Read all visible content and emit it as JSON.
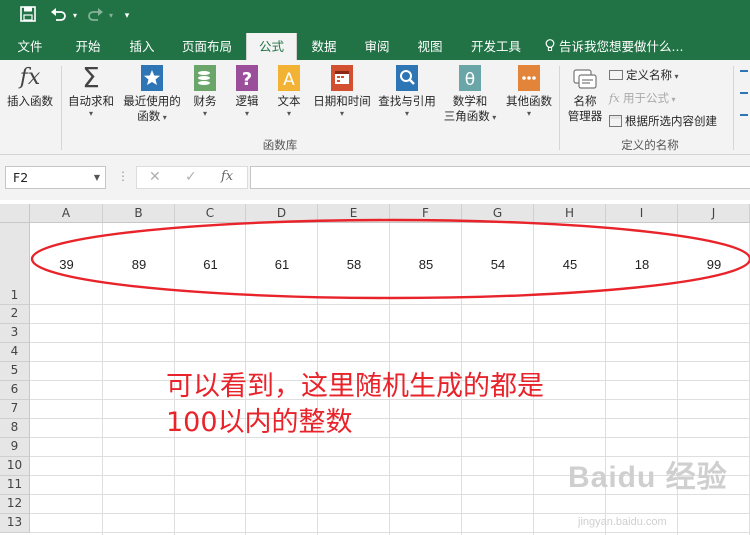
{
  "tabs": [
    "文件",
    "开始",
    "插入",
    "页面布局",
    "公式",
    "数据",
    "审阅",
    "视图",
    "开发工具"
  ],
  "tell_me": "告诉我您想要做什么...",
  "ribbon": {
    "insert_function": "插入函数",
    "autosum": "自动求和",
    "recent_line1": "最近使用的",
    "recent_line2": "函数",
    "financial": "财务",
    "logical": "逻辑",
    "text": "文本",
    "datetime": "日期和时间",
    "lookup": "查找与引用",
    "math_line1": "数学和",
    "math_line2": "三角函数",
    "more": "其他函数",
    "library_label": "函数库",
    "name_mgr_line1": "名称",
    "name_mgr_line2": "管理器",
    "define_name": "定义名称",
    "use_in_formula": "用于公式",
    "create_from_selection": "根据所选内容创建",
    "defined_names_label": "定义的名称"
  },
  "formula_bar": {
    "name_box": "F2",
    "fx": "fx",
    "formula": ""
  },
  "columns": [
    "A",
    "B",
    "C",
    "D",
    "E",
    "F",
    "G",
    "H",
    "I",
    "J"
  ],
  "rows": [
    "1",
    "2",
    "3",
    "4",
    "5",
    "6",
    "7",
    "8",
    "9",
    "10",
    "11",
    "12",
    "13"
  ],
  "row1_values": [
    "39",
    "89",
    "61",
    "61",
    "58",
    "85",
    "54",
    "45",
    "18",
    "99"
  ],
  "annotation": {
    "line1": "可以看到，这里随机生成的都是",
    "line2": "100以内的整数"
  },
  "watermark": {
    "text": "Baidu 经验",
    "url": "jingyan.baidu.com"
  },
  "colors": {
    "excel_green": "#217346",
    "annotation_red": "#e8232a"
  }
}
